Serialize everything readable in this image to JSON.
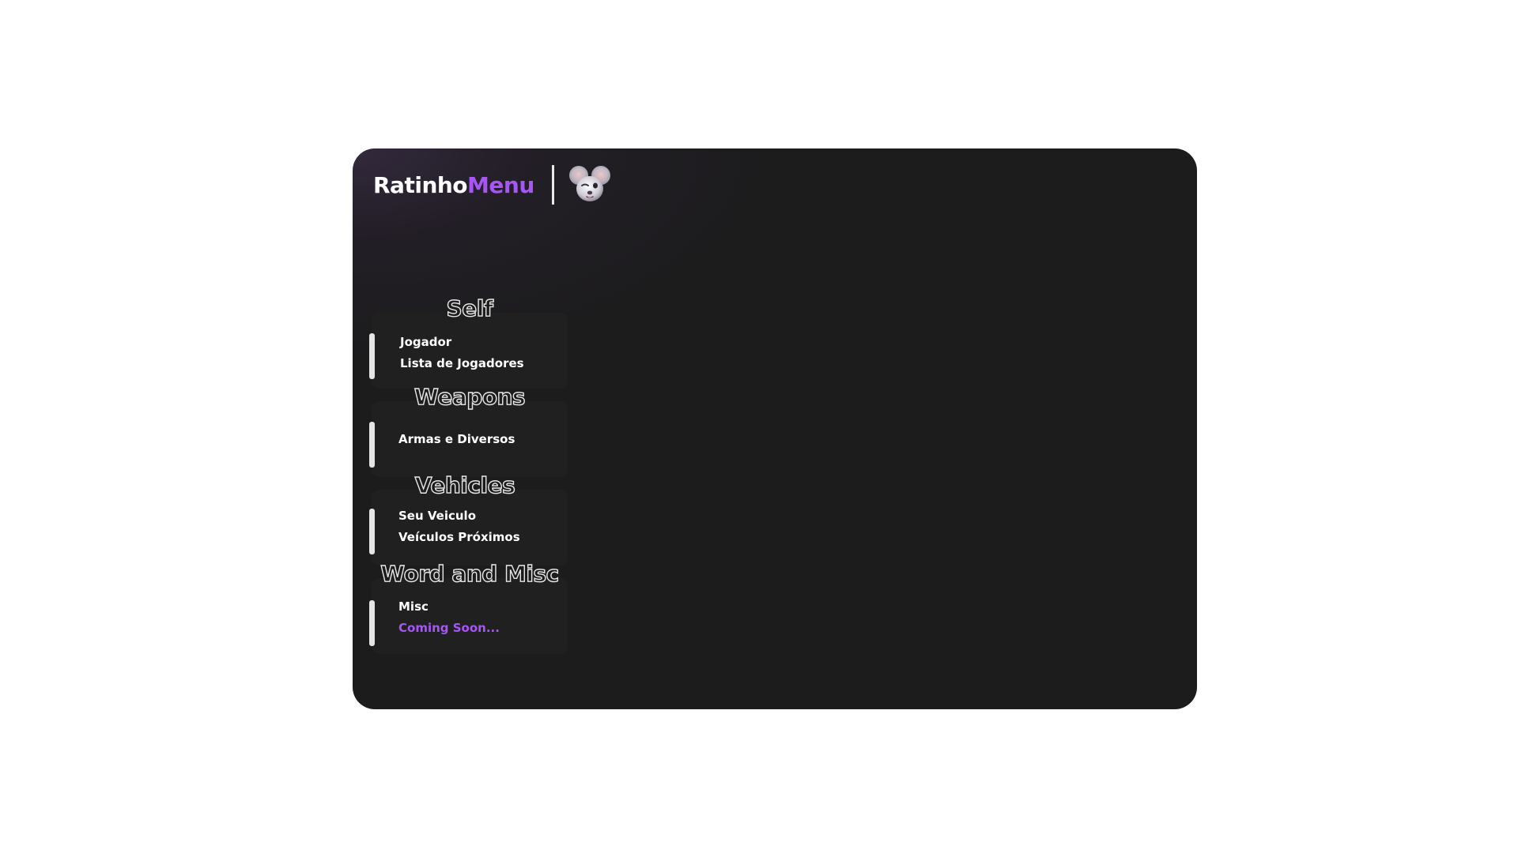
{
  "header": {
    "brand_part1": "Ratinho",
    "brand_part2": "Menu",
    "logo_icon": "mouse-face-icon"
  },
  "colors": {
    "accent": "#a855f7",
    "panel_bg": "#1c1c1d",
    "section_bg": "#202021",
    "text": "#ffffff"
  },
  "sections": [
    {
      "title": "Self",
      "items": [
        {
          "label": "Jogador"
        },
        {
          "label": "Lista de Jogadores"
        }
      ]
    },
    {
      "title": "Weapons",
      "items": [
        {
          "label": "Armas e Diversos"
        }
      ]
    },
    {
      "title": "Vehicles",
      "items": [
        {
          "label": "Seu Veiculo"
        },
        {
          "label": "Veículos Próximos"
        }
      ]
    },
    {
      "title": "Word and Misc",
      "items": [
        {
          "label": "Misc"
        },
        {
          "label": "Coming Soon..."
        }
      ]
    }
  ]
}
